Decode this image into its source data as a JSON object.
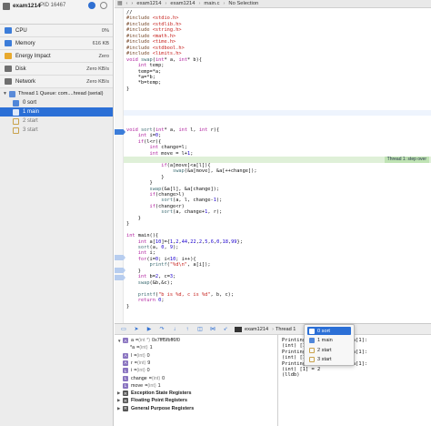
{
  "process": {
    "name": "exam1214",
    "pid_label": "PID 16467"
  },
  "gauges": [
    {
      "label": "CPU",
      "value": "0%",
      "color": "#3c7dd9"
    },
    {
      "label": "Memory",
      "value": "616 KB",
      "color": "#3c7dd9"
    },
    {
      "label": "Energy Impact",
      "value": "Zero",
      "color": "#e8a92d"
    },
    {
      "label": "Disk",
      "value": "Zero KB/s",
      "color": "#6f6f6f"
    },
    {
      "label": "Network",
      "value": "Zero KB/s",
      "color": "#6f6f6f"
    }
  ],
  "thread": {
    "label": "Thread 1 Queue: com....hread (serial)"
  },
  "frames": [
    {
      "label": "0 sort",
      "selected": false
    },
    {
      "label": "1 main",
      "selected": true
    },
    {
      "label": "2 start",
      "selected": false
    },
    {
      "label": "3 start",
      "selected": false
    }
  ],
  "tabbar": {
    "project": "exam1214",
    "folder": "exam1214",
    "file": "main.c",
    "selection": "No Selection"
  },
  "code": [
    "//",
    "#include <stdio.h>",
    "#include <stdlib.h>",
    "#include <string.h>",
    "#include <math.h>",
    "#include <time.h>",
    "#include <stdbool.h>",
    "#include <limits.h>",
    "void swap(int* a, int* b){",
    "    int temp;",
    "    temp=*a;",
    "    *a=*b;",
    "    *b=temp;",
    "}",
    "",
    "",
    "",
    "",
    "",
    "",
    "void sort(int* a, int l, int r){",
    "    int i=0;",
    "    if(l<r){",
    "        int change=l;",
    "        int move = l+1;",
    "        for(; move<r; move++){",
    "            if(a[move]<a[l]){",
    "                swap(&a[move], &a[++change]);",
    "            }",
    "        }",
    "        swap(&a[l], &a[change]);",
    "        if(change>l)",
    "            sort(a, l, change-1);",
    "        if(change<r)",
    "            sort(a, change+1, r);",
    "    }",
    "}",
    "",
    "int main(){",
    "    int a[10]={1,2,44,22,2,5,6,0,18,99};",
    "    sort(a, 0, 9);",
    "    int i;",
    "    for(i=0; i<10; i++){",
    "        printf(\"%d\\n\", a[i]);",
    "    }",
    "    int b=2, c=3;",
    "    swap(&b,&c);",
    "",
    "    printf(\"b is %d, c is %d\", b, c);",
    "    return 0;",
    "}"
  ],
  "highlight": {
    "line_index": 25,
    "annotation": "Thread 1: step over"
  },
  "debugbar": {
    "process": "exam1214",
    "thread": "Thread 1",
    "frame": "0 sort"
  },
  "variables": [
    {
      "tri": "▼",
      "badge": "A",
      "name": "a",
      "type": "(int *)",
      "value": "0x7fff5fbff6f0",
      "indent": 0
    },
    {
      "tri": "",
      "badge": "",
      "name": "*a",
      "type": "(int)",
      "value": "1",
      "indent": 1
    },
    {
      "tri": "",
      "badge": "A",
      "name": "l",
      "type": "(int)",
      "value": "0",
      "indent": 0
    },
    {
      "tri": "",
      "badge": "A",
      "name": "r",
      "type": "(int)",
      "value": "9",
      "indent": 0
    },
    {
      "tri": "",
      "badge": "L",
      "name": "i",
      "type": "(int)",
      "value": "0",
      "indent": 0
    },
    {
      "tri": "",
      "badge": "L",
      "name": "change",
      "type": "(int)",
      "value": "0",
      "indent": 0
    },
    {
      "tri": "",
      "badge": "L",
      "name": "move",
      "type": "(int)",
      "value": "1",
      "indent": 0
    },
    {
      "tri": "▶",
      "badge": "R",
      "name": "Exception State Registers",
      "type": "",
      "value": "",
      "indent": 0
    },
    {
      "tri": "▶",
      "badge": "R",
      "name": "Floating Point Registers",
      "type": "",
      "value": "",
      "indent": 0
    },
    {
      "tri": "▶",
      "badge": "R",
      "name": "General Purpose Registers",
      "type": "",
      "value": "",
      "indent": 0
    }
  ],
  "console": [
    "Printing description of a[1]:",
    "(int) [1] = 2",
    "Printing description of a[1]:",
    "(int) [1] = 2",
    "Printing description of a[1]:",
    "(int) [1] = 2",
    "(lldb)"
  ],
  "popup": {
    "items": [
      "0 sort",
      "1 main",
      "2 start",
      "3 start"
    ],
    "selected": 0
  }
}
